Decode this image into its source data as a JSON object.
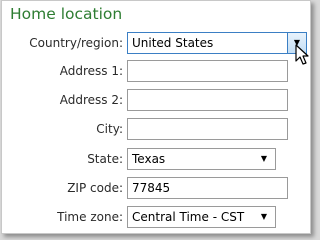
{
  "section_title": "Home location",
  "country": {
    "label": "Country/region:",
    "value": "United States"
  },
  "address1": {
    "label": "Address 1:",
    "value": ""
  },
  "address2": {
    "label": "Address 2:",
    "value": ""
  },
  "city": {
    "label": "City:",
    "value": ""
  },
  "state": {
    "label": "State:",
    "value": "Texas"
  },
  "zip": {
    "label": "ZIP code:",
    "value": "77845"
  },
  "timezone": {
    "label": "Time zone:",
    "value": "Central Time - CST"
  },
  "icons": {
    "dropdown": "chevron-down-icon",
    "cursor": "mouse-pointer-icon"
  },
  "colors": {
    "title": "#2e7d32",
    "focus_border": "#3b7fc4"
  }
}
